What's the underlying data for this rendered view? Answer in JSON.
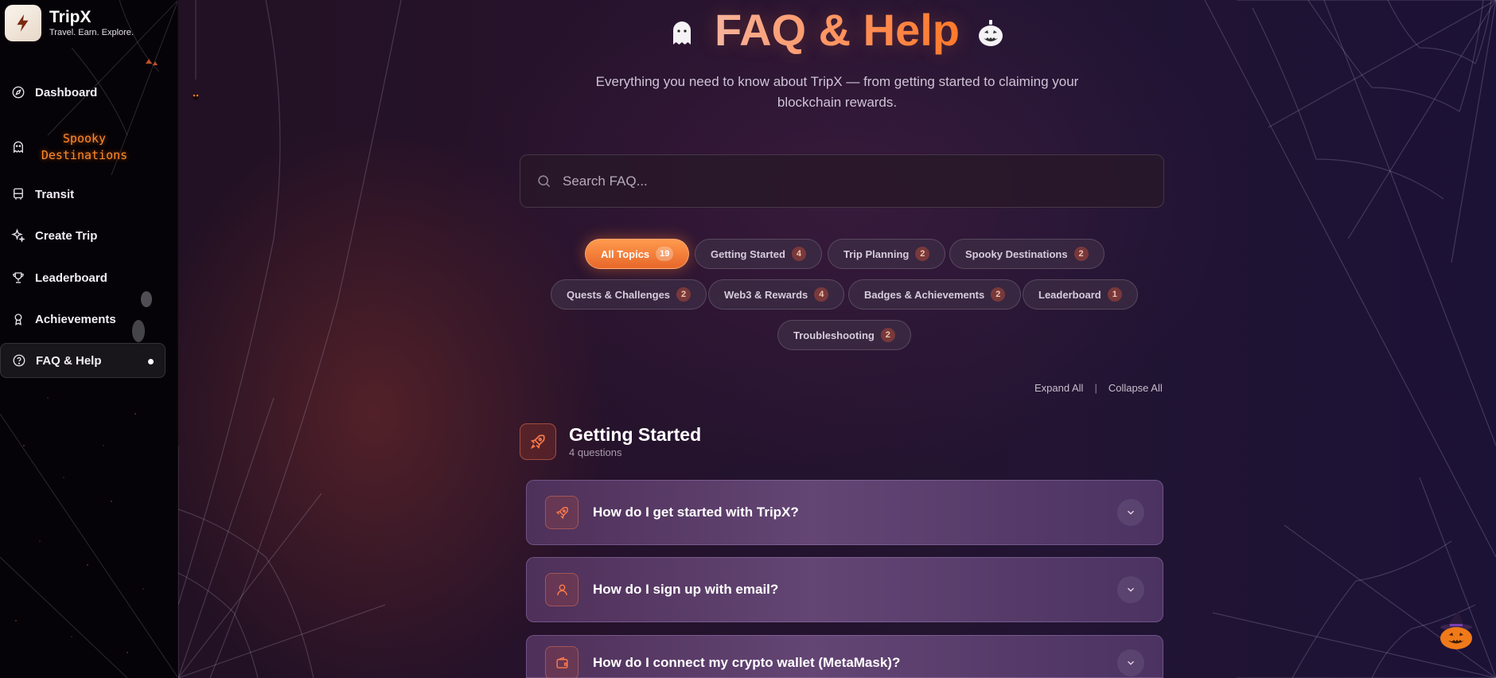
{
  "brand": {
    "name": "TripX",
    "tagline": "Travel. Earn. Explore."
  },
  "sidebar": {
    "items": [
      {
        "label": "Dashboard",
        "icon": "compass-icon"
      },
      {
        "label": "Spooky Destinations",
        "icon": "ghost-icon"
      },
      {
        "label": "Transit",
        "icon": "bus-icon"
      },
      {
        "label": "Create Trip",
        "icon": "sparkles-icon"
      },
      {
        "label": "Leaderboard",
        "icon": "trophy-icon"
      },
      {
        "label": "Achievements",
        "icon": "award-icon"
      },
      {
        "label": "FAQ & Help",
        "icon": "help-circle-icon",
        "active": true
      }
    ]
  },
  "page": {
    "title": "FAQ & Help",
    "subtitle": "Everything you need to know about TripX — from getting started to claiming your blockchain rewards."
  },
  "search": {
    "placeholder": "Search FAQ..."
  },
  "filters": [
    {
      "label": "All Topics",
      "count": "19",
      "active": true
    },
    {
      "label": "Getting Started",
      "count": "4"
    },
    {
      "label": "Trip Planning",
      "count": "2"
    },
    {
      "label": "Spooky Destinations",
      "count": "2"
    },
    {
      "label": "Quests & Challenges",
      "count": "2"
    },
    {
      "label": "Web3 & Rewards",
      "count": "4"
    },
    {
      "label": "Badges & Achievements",
      "count": "2"
    },
    {
      "label": "Leaderboard",
      "count": "1"
    },
    {
      "label": "Troubleshooting",
      "count": "2"
    }
  ],
  "controls": {
    "expand_all": "Expand All",
    "separator": "|",
    "collapse_all": "Collapse All"
  },
  "section": {
    "title": "Getting Started",
    "subtitle": "4 questions",
    "icon": "rocket-icon",
    "questions": [
      {
        "q": "How do I get started with TripX?",
        "icon": "rocket-icon"
      },
      {
        "q": "How do I sign up with email?",
        "icon": "user-icon"
      },
      {
        "q": "How do I connect my crypto wallet (MetaMask)?",
        "icon": "wallet-icon"
      }
    ]
  },
  "colors": {
    "accent": "#ff7a2a",
    "sidebar_bg": "#050307",
    "card_bg": "#684878",
    "chip_active": "#f07a36"
  }
}
